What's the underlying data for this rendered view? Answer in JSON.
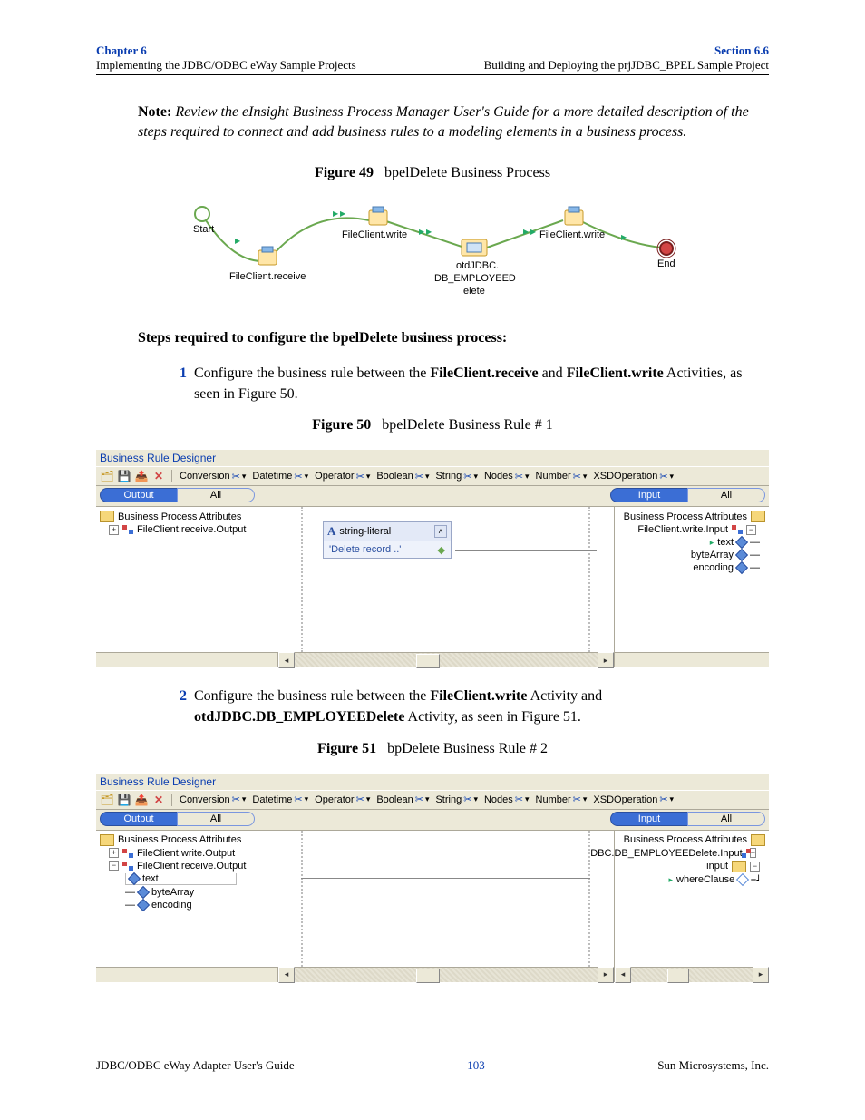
{
  "header": {
    "chapter": "Chapter 6",
    "chapter_sub": "Implementing the JDBC/ODBC eWay Sample Projects",
    "section": "Section 6.6",
    "section_sub": "Building and Deploying the prjJDBC_BPEL Sample Project"
  },
  "note": {
    "label": "Note:",
    "text": "Review the eInsight Business Process Manager User's Guide for a more detailed description of the steps required to connect and add business rules to a modeling elements in a business process."
  },
  "fig49": {
    "label": "Figure 49",
    "title": "bpelDelete Business Process",
    "nodes": {
      "start": "Start",
      "receive": "FileClient.receive",
      "write1": "FileClient.write",
      "jdbc_top": "otdJDBC.",
      "jdbc_mid": "DB_EMPLOYEED",
      "jdbc_bot": "elete",
      "write2": "FileClient.write",
      "end": "End"
    }
  },
  "steps_heading": "Steps required to configure the bpelDelete business process:",
  "step1": {
    "num": "1",
    "pre": "Configure the business rule between the ",
    "b1": "FileClient.receive",
    "mid": " and ",
    "b2": "FileClient.write",
    "post": " Activities, as seen in Figure 50."
  },
  "fig50": {
    "label": "Figure 50",
    "title": "bpelDelete Business Rule # 1"
  },
  "designer_title": "Business Rule Designer",
  "toolbar_menus": [
    "Conversion",
    "Datetime",
    "Operator",
    "Boolean",
    "String",
    "Nodes",
    "Number",
    "XSDOperation"
  ],
  "tabs": {
    "output": "Output",
    "all": "All",
    "input": "Input"
  },
  "rule1": {
    "left_root": "Business Process Attributes",
    "left_item": "FileClient.receive.Output",
    "literal_label": "string-literal",
    "literal_value": "'Delete record ..'",
    "right_root": "Business Process Attributes",
    "right_item": "FileClient.write.Input",
    "right_leaves": [
      "text",
      "byteArray",
      "encoding"
    ]
  },
  "step2": {
    "num": "2",
    "pre": "Configure the business rule between the ",
    "b1": "FileClient.write",
    "mid1": " Activity and ",
    "b2": "otdJDBC.DB_EMPLOYEEDelete",
    "mid2": " Activity, as seen in Figure 51."
  },
  "fig51": {
    "label": "Figure 51",
    "title": "bpDelete Business Rule # 2"
  },
  "rule2": {
    "left_root": "Business Process Attributes",
    "left_items": [
      "FileClient.write.Output",
      "FileClient.receive.Output"
    ],
    "left_leaves": [
      "text",
      "byteArray",
      "encoding"
    ],
    "right_root": "Business Process Attributes",
    "right_item": "DBC.DB_EMPLOYEEDelete.Input",
    "right_sub": "input",
    "right_leaf": "whereClause"
  },
  "footer": {
    "left": "JDBC/ODBC eWay Adapter User's Guide",
    "page": "103",
    "right": "Sun Microsystems, Inc."
  }
}
